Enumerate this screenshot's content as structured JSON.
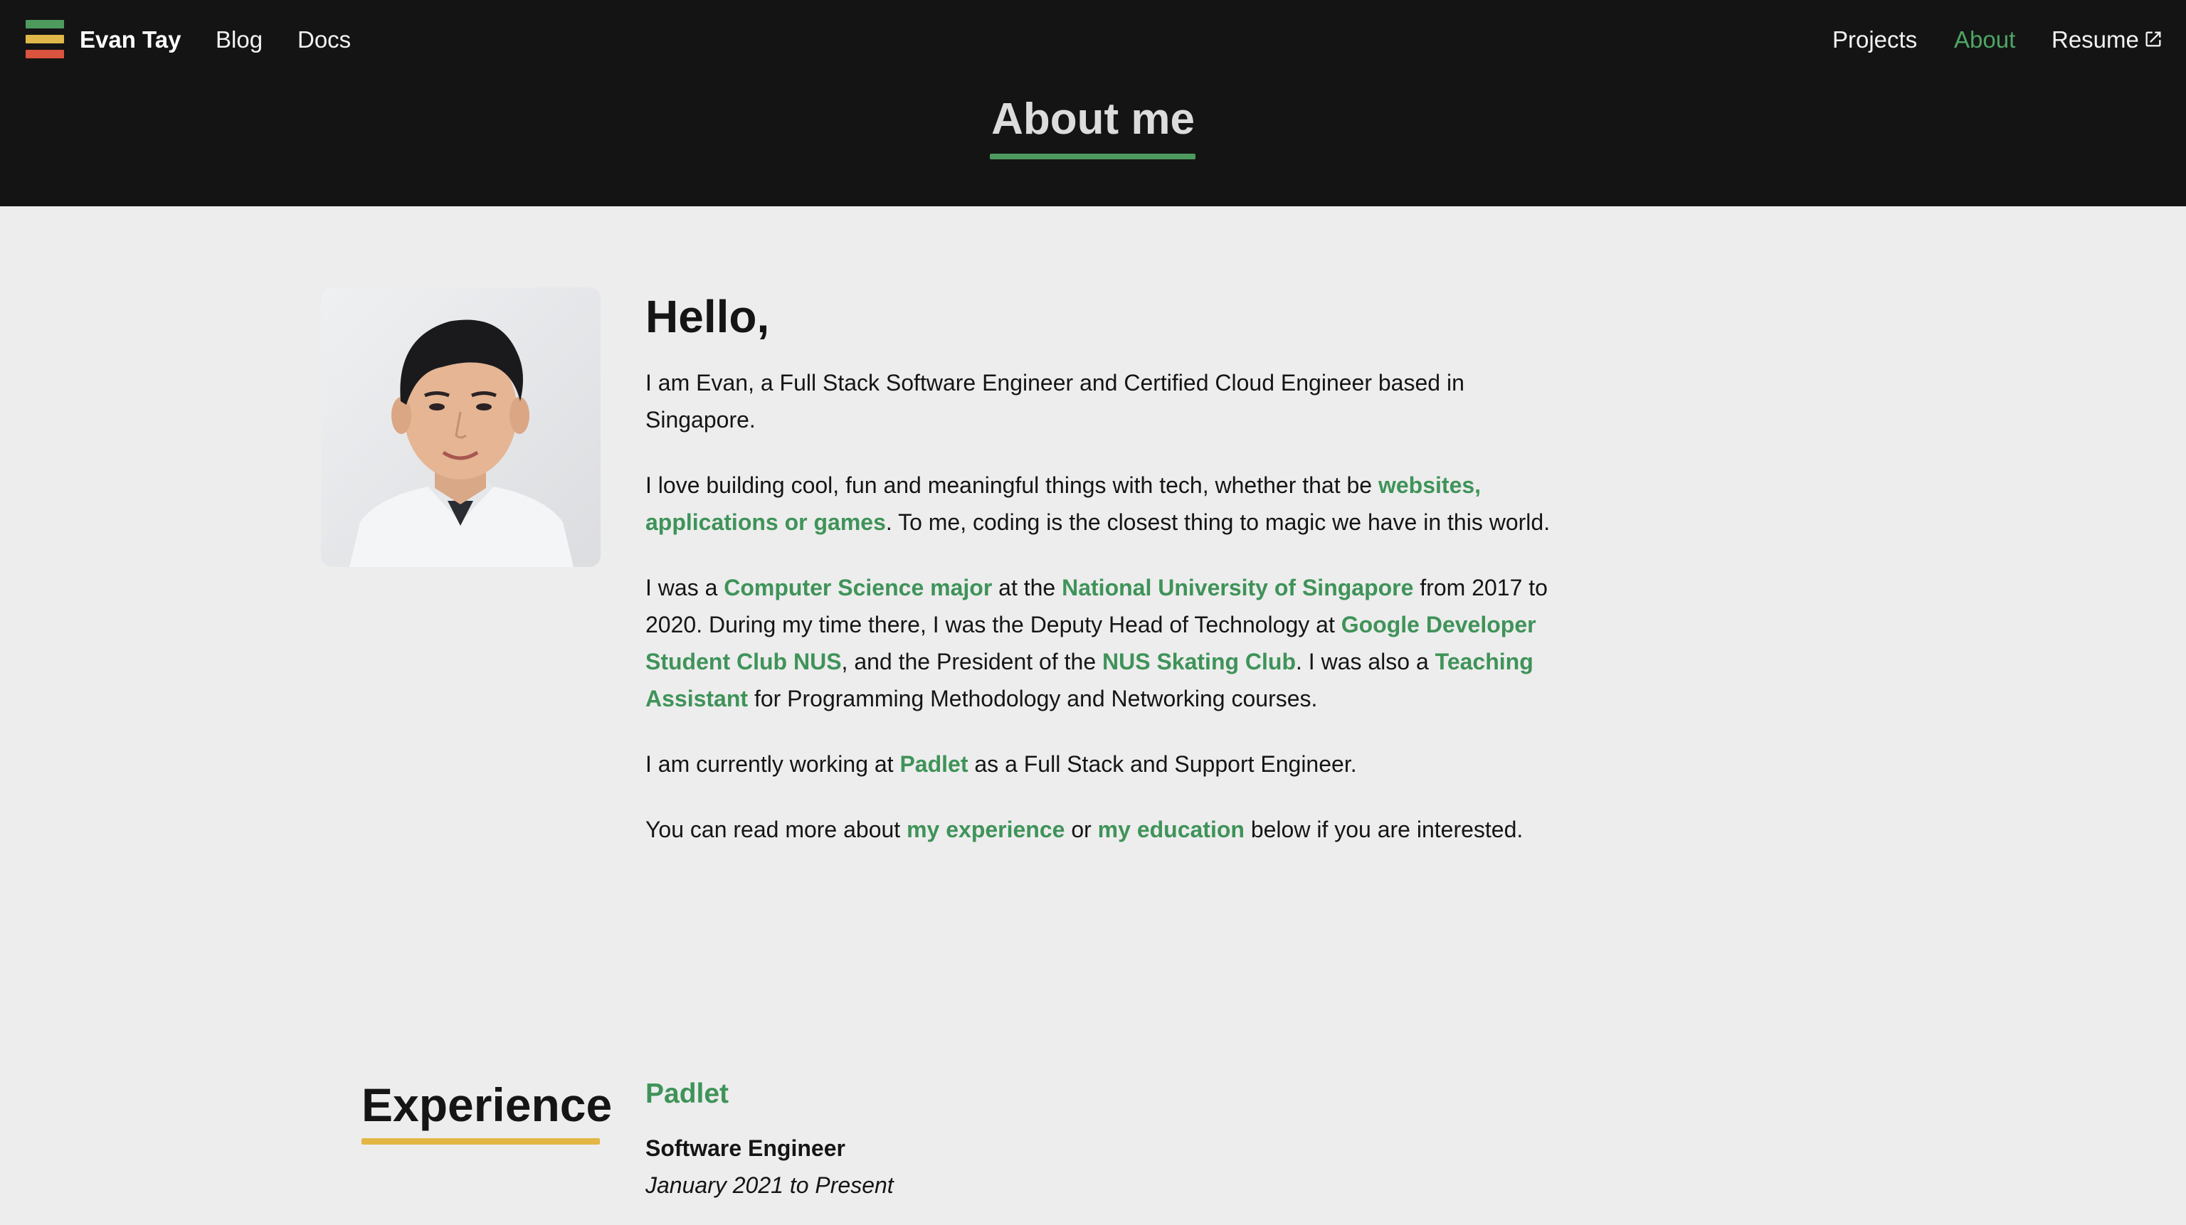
{
  "nav": {
    "brand": "Evan Tay",
    "blog": "Blog",
    "docs": "Docs",
    "projects": "Projects",
    "about": "About",
    "resume": "Resume"
  },
  "header": {
    "title": "About me"
  },
  "intro": {
    "heading": "Hello,",
    "p1": "I am Evan, a Full Stack Software Engineer and Certified Cloud Engineer based in Singapore.",
    "p2_before": "I love building cool, fun and meaningful things with tech, whether that be ",
    "p2_link": "websites, applications or games",
    "p2_after": ". To me, coding is the closest thing to magic we have in this world.",
    "p3_t1": "I was a ",
    "p3_l1": "Computer Science major",
    "p3_t2": " at the ",
    "p3_l2": "National University of Singapore",
    "p3_t3": " from 2017 to 2020. During my time there, I was the Deputy Head of Technology at ",
    "p3_l3": "Google Developer Student Club NUS",
    "p3_t4": ", and the President of the ",
    "p3_l4": "NUS Skating Club",
    "p3_t5": ". I was also a ",
    "p3_l5": "Teaching Assistant",
    "p3_t6": " for Programming Methodology and Networking courses.",
    "p4_before": "I am currently working at ",
    "p4_link": "Padlet",
    "p4_after": " as a Full Stack and Support Engineer.",
    "p5_t1": "You can read more about ",
    "p5_l1": "my experience",
    "p5_t2": " or ",
    "p5_l2": "my education",
    "p5_t3": " below if you are interested."
  },
  "experience": {
    "title": "Experience",
    "company": "Padlet",
    "role": "Software Engineer",
    "period": "January 2021 to Present"
  },
  "colors": {
    "accent_green": "#3f9359",
    "accent_yellow": "#e3b646",
    "accent_red": "#d9533f",
    "header_bg": "#141414",
    "page_bg": "#ededed"
  }
}
